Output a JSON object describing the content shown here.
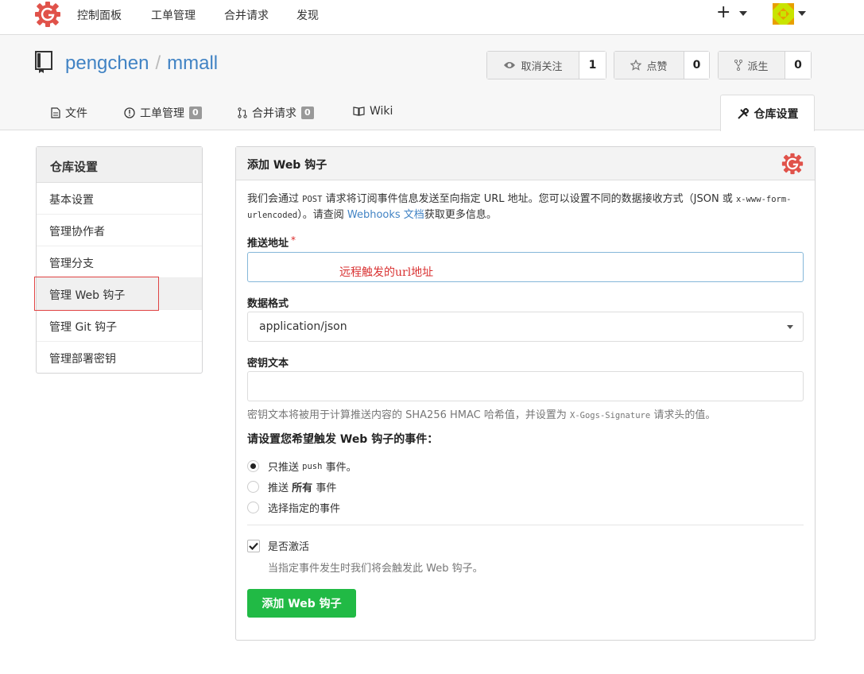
{
  "topnav": {
    "logo": "gogs-logo-icon",
    "items": [
      "控制面板",
      "工单管理",
      "合并请求",
      "发现"
    ],
    "plus_label": "+"
  },
  "repo": {
    "owner": "pengchen",
    "separator": "/",
    "name": "mmall",
    "watch": {
      "label": "取消关注",
      "count": "1"
    },
    "star": {
      "label": "点赞",
      "count": "0"
    },
    "fork": {
      "label": "派生",
      "count": "0"
    }
  },
  "tabs": {
    "files": "文件",
    "issues": {
      "label": "工单管理",
      "count": "0"
    },
    "pulls": {
      "label": "合并请求",
      "count": "0"
    },
    "wiki": "Wiki",
    "settings": "仓库设置"
  },
  "sidebar": {
    "title": "仓库设置",
    "items": [
      "基本设置",
      "管理协作者",
      "管理分支",
      "管理 Web 钩子",
      "管理 Git 钩子",
      "管理部署密钥"
    ],
    "active_index": 3
  },
  "form": {
    "title": "添加 Web 钩子",
    "desc_part1": "我们会通过",
    "desc_post": "POST",
    "desc_part2": "请求将订阅事件信息发送至向指定 URL 地址。您可以设置不同的数据接收方式（JSON 或",
    "desc_mono2": "x-www-form-urlencoded",
    "desc_part3": "）。请查阅",
    "desc_link": "Webhooks 文档",
    "desc_part4": "获取更多信息。",
    "payload_url_label": "推送地址",
    "required_mark": "*",
    "payload_url_annotation": "远程触发的url地址",
    "content_type_label": "数据格式",
    "content_type_value": "application/json",
    "secret_label": "密钥文本",
    "secret_help_part1": "密钥文本将被用于计算推送内容的 SHA256 HMAC 哈希值，并设置为",
    "secret_help_mono": "X-Gogs-Signature",
    "secret_help_part2": "请求头的值。",
    "events_title": "请设置您希望触发 Web 钩子的事件：",
    "event_push_prefix": "只推送",
    "event_push_mono": "push",
    "event_push_suffix": "事件。",
    "event_all_prefix": "推送",
    "event_all_bold": "所有",
    "event_all_suffix": "事件",
    "event_choose": "选择指定的事件",
    "active_label": "是否激活",
    "active_help": "当指定事件发生时我们将会触发此 Web 钩子。",
    "submit": "添加 Web 钩子"
  },
  "colors": {
    "link": "#4183c4",
    "submit": "#21ba45",
    "annotation": "#d93333",
    "logo": "#e0524a"
  }
}
